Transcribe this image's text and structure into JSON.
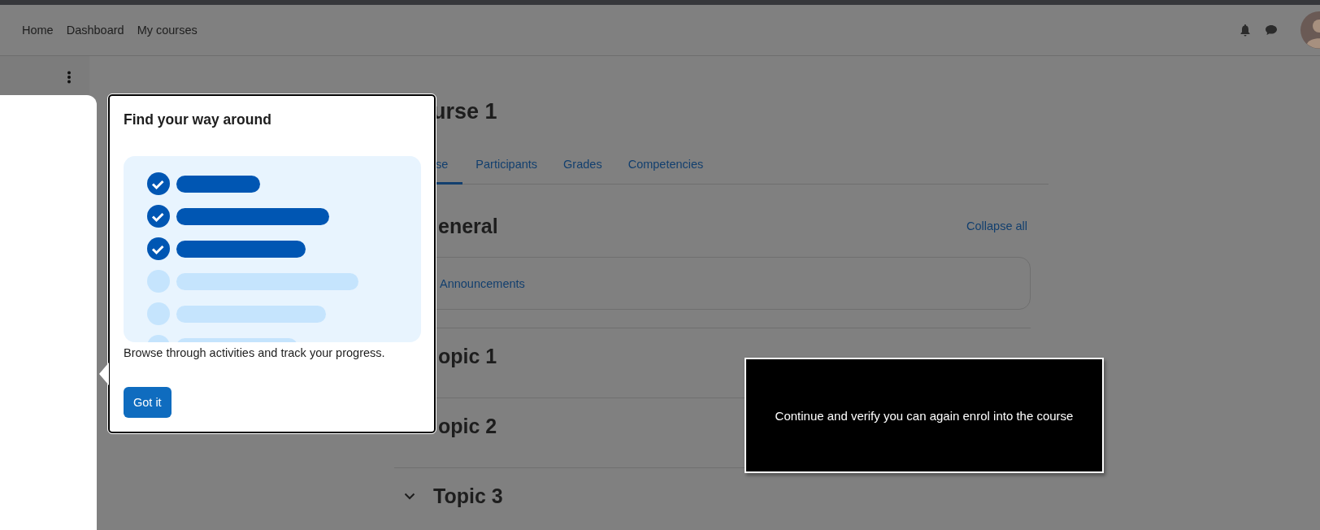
{
  "nav": {
    "links": [
      "Home",
      "Dashboard",
      "My courses"
    ]
  },
  "course": {
    "title": "urse 1",
    "tabs": [
      {
        "label": "se",
        "selected": true
      },
      {
        "label": "Participants",
        "selected": false
      },
      {
        "label": "Grades",
        "selected": false
      },
      {
        "label": "Competencies",
        "selected": false
      }
    ]
  },
  "sections": [
    {
      "kind": "cut",
      "title": "eneral",
      "action": "Collapse all",
      "activities": [
        "Announcements"
      ]
    },
    {
      "kind": "cut",
      "title": "opic 1"
    },
    {
      "kind": "cut",
      "title": "opic 2"
    },
    {
      "kind": "whole",
      "title": "Topic 3",
      "expanded": true
    }
  ],
  "tour": {
    "title": "Find your way around",
    "text": "Browse through activities and track your progress.",
    "button": "Got it"
  },
  "notice": {
    "text": "Continue and verify you can again enrol into the course"
  }
}
